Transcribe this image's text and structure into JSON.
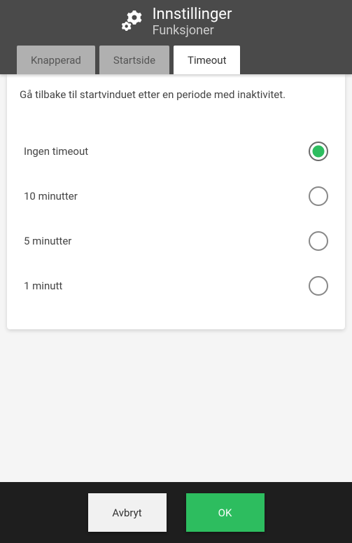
{
  "header": {
    "title": "Innstillinger",
    "subtitle": "Funksjoner"
  },
  "tabs": [
    {
      "label": "Knapperad",
      "active": false
    },
    {
      "label": "Startside",
      "active": false
    },
    {
      "label": "Timeout",
      "active": true
    }
  ],
  "panel": {
    "description": "Gå tilbake til startvinduet etter en periode med inaktivitet.",
    "options": [
      {
        "label": "Ingen timeout",
        "selected": true
      },
      {
        "label": "10 minutter",
        "selected": false
      },
      {
        "label": "5 minutter",
        "selected": false
      },
      {
        "label": "1 minutt",
        "selected": false
      }
    ]
  },
  "footer": {
    "cancel": "Avbryt",
    "ok": "OK"
  }
}
